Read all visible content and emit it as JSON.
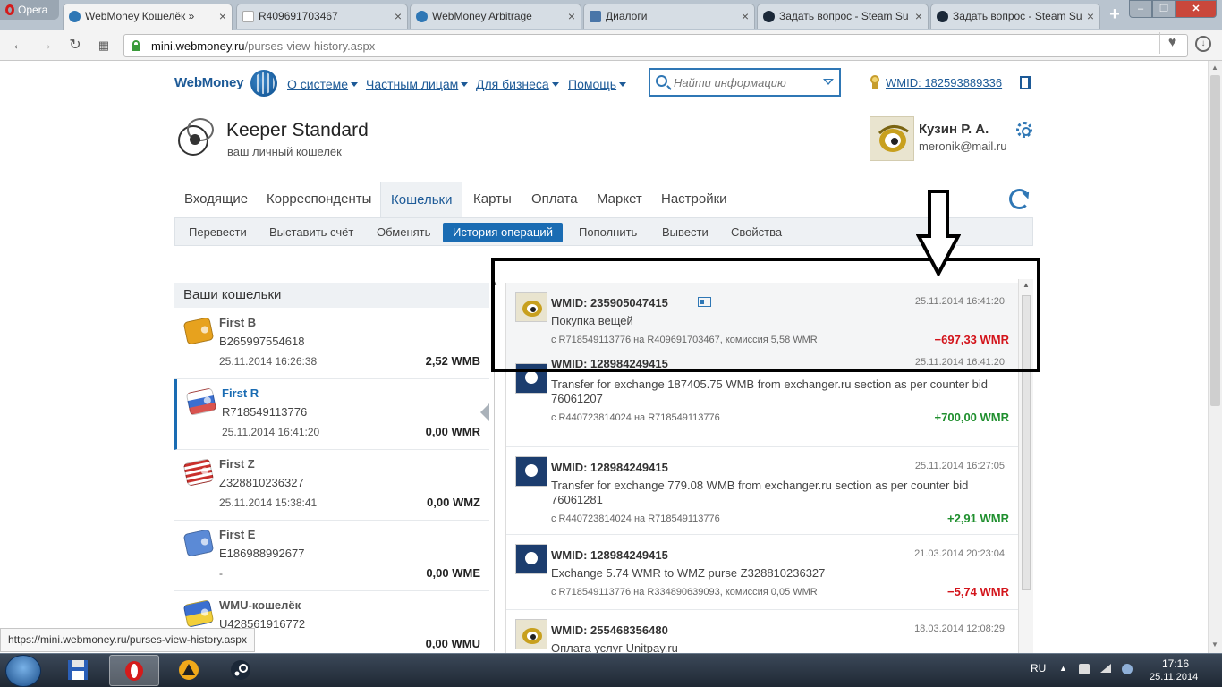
{
  "browser": {
    "menu_label": "Opera",
    "tabs": [
      {
        "title": "WebMoney Кошелёк »",
        "active": true
      },
      {
        "title": "R409691703467",
        "active": false
      },
      {
        "title": "WebMoney Arbitrage",
        "active": false
      },
      {
        "title": "Диалоги",
        "active": false
      },
      {
        "title": "Задать вопрос - Steam Su",
        "active": false
      },
      {
        "title": "Задать вопрос - Steam Su",
        "active": false
      }
    ],
    "url_host": "mini.webmoney.ru",
    "url_path": "/purses-view-history.aspx",
    "status_url": "https://mini.webmoney.ru/purses-view-history.aspx"
  },
  "header": {
    "logo": "WebMoney",
    "menu": [
      "О системе",
      "Частным лицам",
      "Для бизнеса",
      "Помощь"
    ],
    "search_placeholder": "Найти информацию",
    "wmid_label": "WMID: 182593889336"
  },
  "keeper": {
    "title": "Keeper Standard",
    "subtitle": "ваш личный кошелёк"
  },
  "user": {
    "name": "Кузин Р. А.",
    "email": "meronik@mail.ru"
  },
  "main_tabs": [
    {
      "label": "Входящие",
      "active": false
    },
    {
      "label": "Корреспонденты",
      "active": false
    },
    {
      "label": "Кошельки",
      "active": true
    },
    {
      "label": "Карты",
      "active": false
    },
    {
      "label": "Оплата",
      "active": false
    },
    {
      "label": "Маркет",
      "active": false
    },
    {
      "label": "Настройки",
      "active": false
    }
  ],
  "sub_tabs": [
    {
      "label": "Перевести",
      "active": false
    },
    {
      "label": "Выставить счёт",
      "active": false
    },
    {
      "label": "Обменять",
      "active": false
    },
    {
      "label": "История операций",
      "active": true
    },
    {
      "label": "Пополнить",
      "active": false
    },
    {
      "label": "Вывести",
      "active": false
    },
    {
      "label": "Свойства",
      "active": false
    }
  ],
  "purses_title": "Ваши кошельки",
  "purses": [
    {
      "name": "First B",
      "number": "B265997554618",
      "date": "25.11.2014 16:26:38",
      "balance": "2,52 WMB",
      "color": "#e7a21e",
      "active": false
    },
    {
      "name": "First R",
      "number": "R718549113776",
      "date": "25.11.2014 16:41:20",
      "balance": "0,00 WMR",
      "color": "#d9534f",
      "active": true
    },
    {
      "name": "First Z",
      "number": "Z328810236327",
      "date": "25.11.2014 15:38:41",
      "balance": "0,00 WMZ",
      "color": "#e8a13c",
      "active": false
    },
    {
      "name": "First E",
      "number": "E186988992677",
      "date": "-",
      "balance": "0,00 WME",
      "color": "#5b8ad6",
      "active": false
    },
    {
      "name": "WMU-кошелёк",
      "number": "U428561916772",
      "date": "",
      "balance": "0,00 WMU",
      "color": "#e6b12e",
      "active": false
    }
  ],
  "operations": [
    {
      "wmid": "WMID: 235905047415",
      "date": "25.11.2014 16:41:20",
      "desc": "Покупка вещей",
      "route": "с R718549113776 на R409691703467, комиссия 5,58 WMR",
      "amount": "−697,33 WMR",
      "sign": "neg",
      "avatar": "keeper",
      "card": true
    },
    {
      "wmid": "WMID: 128984249415",
      "date": "25.11.2014 16:41:20",
      "desc": "Transfer for exchange 187405.75 WMB from exchanger.ru section as per counter bid 76061207",
      "route": "с R440723814024 на R718549113776",
      "amount": "+700,00 WMR",
      "sign": "pos",
      "avatar": "exch",
      "card": false
    },
    {
      "wmid": "WMID: 128984249415",
      "date": "25.11.2014 16:27:05",
      "desc": "Transfer for exchange 779.08 WMB from exchanger.ru section as per counter bid 76061281",
      "route": "с R440723814024 на R718549113776",
      "amount": "+2,91 WMR",
      "sign": "pos",
      "avatar": "exch",
      "card": false
    },
    {
      "wmid": "WMID: 128984249415",
      "date": "21.03.2014 20:23:04",
      "desc": "Exchange 5.74 WMR to WMZ purse Z328810236327",
      "route": "с R718549113776 на R334890639093, комиссия 0,05 WMR",
      "amount": "−5,74 WMR",
      "sign": "neg",
      "avatar": "exch",
      "card": false
    },
    {
      "wmid": "WMID: 255468356480",
      "date": "18.03.2014 12:08:29",
      "desc": "Оплата услуг Unitpay.ru",
      "route": "",
      "amount": "",
      "sign": "neg",
      "avatar": "keeper",
      "card": false
    }
  ],
  "taskbar": {
    "lang": "RU",
    "time": "17:16",
    "date": "25.11.2014"
  },
  "colors": {
    "accent": "#1a6cb3",
    "negative": "#d3141b",
    "positive": "#1f8f2e"
  }
}
